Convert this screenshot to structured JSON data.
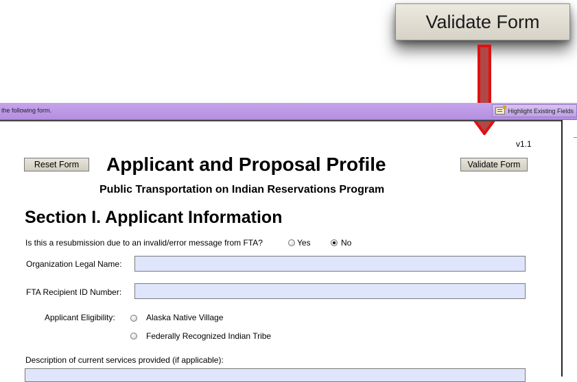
{
  "callout": {
    "button_label": "Validate Form"
  },
  "message_bar": {
    "text": "the following form.",
    "highlight_button_label": "Highlight Existing Fields",
    "highlight_icon": "highlight-fields-icon"
  },
  "form": {
    "version": "v1.1",
    "reset_button_label": "Reset Form",
    "validate_button_label": "Validate Form",
    "title": "Applicant and Proposal Profile",
    "subtitle": "Public Transportation on Indian Reservations Program",
    "section_heading": "Section I. Applicant Information",
    "resubmission": {
      "question": "Is this a resubmission due to an invalid/error message from FTA?",
      "options": [
        "Yes",
        "No"
      ],
      "selected": "No"
    },
    "fields": {
      "org_legal_name_label": "Organization Legal Name:",
      "org_legal_name_value": "",
      "fta_recipient_id_label": "FTA Recipient ID Number:",
      "fta_recipient_id_value": ""
    },
    "eligibility": {
      "label": "Applicant Eligibility:",
      "options": [
        "Alaska Native Village",
        "Federally Recognized Indian Tribe"
      ],
      "selected": null
    },
    "description_label": "Description of current services provided (if applicable):",
    "description_value": ""
  },
  "colors": {
    "message_bar": "#b48fe0",
    "field_fill": "#dfe5fb",
    "arrow": "#e01010",
    "arrow_fill": "#b04848"
  }
}
